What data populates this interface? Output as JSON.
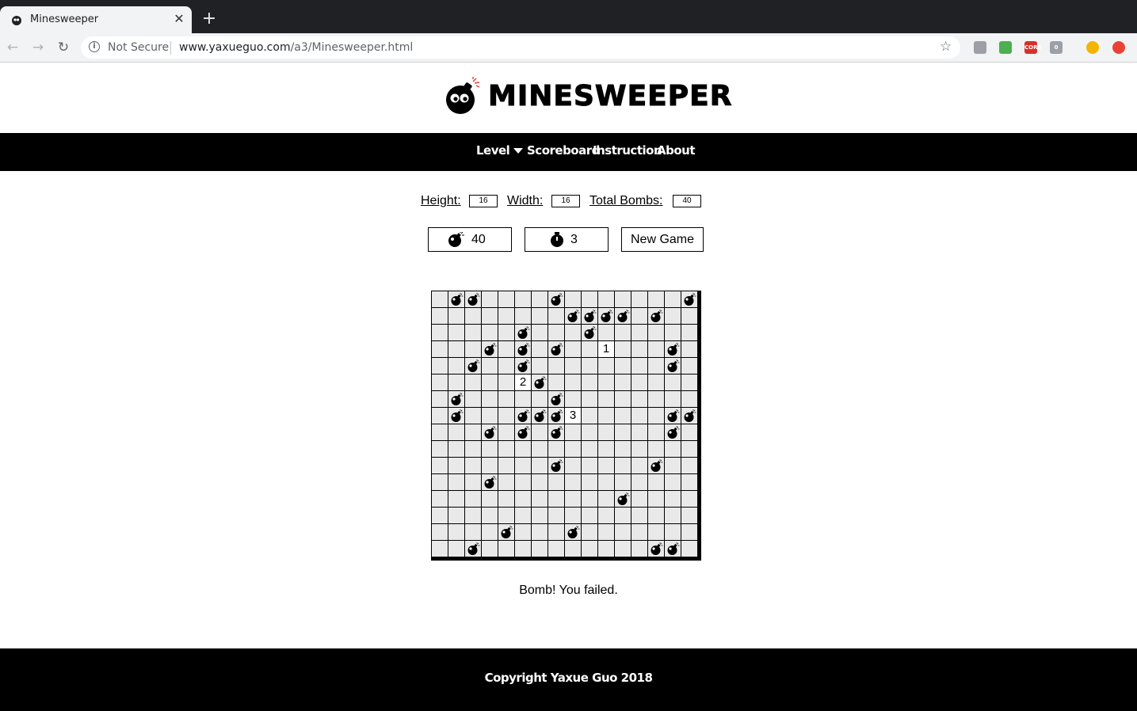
{
  "browser": {
    "tab_title": "Minesweeper",
    "tab_close": "✕",
    "new_tab": "+",
    "back": "←",
    "forward": "→",
    "reload": "↻",
    "not_secure": "Not Secure",
    "url_host": "www.yaxueguo.com",
    "url_path": "/a3/Minesweeper.html",
    "star": "☆",
    "extensions": [
      {
        "name": "camera-extension-icon",
        "label": "",
        "color": "#9aa0a6"
      },
      {
        "name": "shield-extension-icon",
        "label": "",
        "color": "#4caf50"
      },
      {
        "name": "cors-extension-icon",
        "label": "CORS",
        "color": "#d93025"
      },
      {
        "name": "grey-extension-icon",
        "label": "0",
        "color": "#9aa0a6"
      },
      {
        "name": "emoji-extension-icon",
        "label": "",
        "color": "#f5b400"
      },
      {
        "name": "record-extension-icon",
        "label": "",
        "color": "#ea4335"
      }
    ]
  },
  "header": {
    "logo_text": "MINESWEEPER"
  },
  "nav": {
    "level": "Level",
    "scoreboard": "Scoreboard",
    "instruction": "Instruction",
    "about": "About"
  },
  "settings": {
    "height_label": "Height:",
    "height_value": "16",
    "width_label": "Width:",
    "width_value": "16",
    "bombs_label": "Total Bombs:",
    "bombs_value": "40"
  },
  "controls": {
    "bomb_count": "40",
    "timer": "3",
    "new_game": "New Game"
  },
  "board": {
    "rows": 16,
    "cols": 16,
    "mines": [
      [
        0,
        1
      ],
      [
        0,
        2
      ],
      [
        0,
        7
      ],
      [
        0,
        15
      ],
      [
        1,
        8
      ],
      [
        1,
        9
      ],
      [
        1,
        10
      ],
      [
        1,
        11
      ],
      [
        1,
        13
      ],
      [
        2,
        5
      ],
      [
        2,
        9
      ],
      [
        3,
        3
      ],
      [
        3,
        5
      ],
      [
        3,
        7
      ],
      [
        3,
        14
      ],
      [
        4,
        2
      ],
      [
        4,
        5
      ],
      [
        4,
        14
      ],
      [
        5,
        6
      ],
      [
        6,
        1
      ],
      [
        6,
        7
      ],
      [
        7,
        1
      ],
      [
        7,
        5
      ],
      [
        7,
        6
      ],
      [
        7,
        7
      ],
      [
        7,
        14
      ],
      [
        7,
        15
      ],
      [
        8,
        3
      ],
      [
        8,
        5
      ],
      [
        8,
        7
      ],
      [
        8,
        14
      ],
      [
        10,
        7
      ],
      [
        10,
        13
      ],
      [
        11,
        3
      ],
      [
        12,
        11
      ],
      [
        14,
        4
      ],
      [
        14,
        8
      ],
      [
        15,
        2
      ],
      [
        15,
        13
      ],
      [
        15,
        14
      ]
    ],
    "revealed": [
      {
        "r": 3,
        "c": 10,
        "v": "1"
      },
      {
        "r": 5,
        "c": 5,
        "v": "2"
      },
      {
        "r": 7,
        "c": 8,
        "v": "3"
      }
    ]
  },
  "status": {
    "message": "Bomb! You failed."
  },
  "footer": {
    "copyright": "Copyright Yaxue Guo 2018"
  }
}
